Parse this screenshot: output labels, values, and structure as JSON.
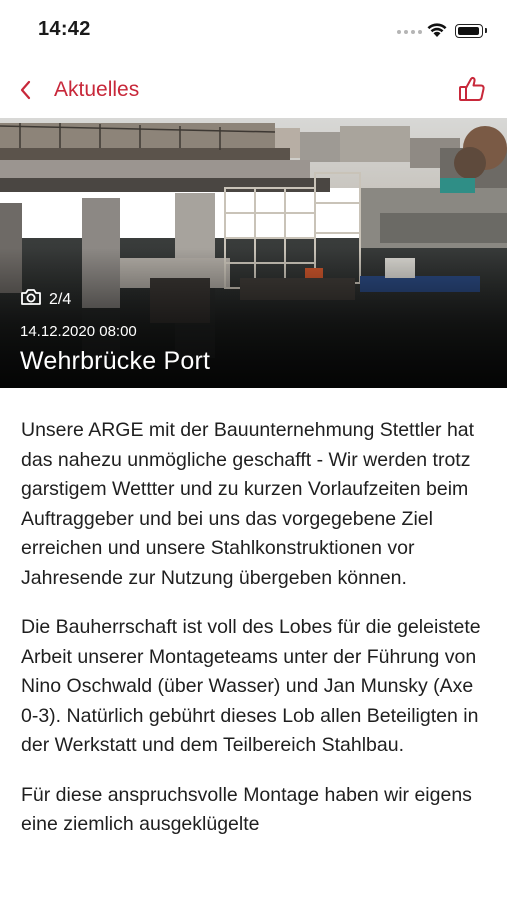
{
  "status_bar": {
    "time": "14:42"
  },
  "nav": {
    "back_label": "Aktuelles",
    "accent_color": "#c8283a"
  },
  "hero": {
    "photo_counter": "2/4",
    "date": "14.12.2020 08:00",
    "title": "Wehrbrücke Port"
  },
  "article": {
    "paragraphs": [
      "Unsere ARGE mit der Bauunternehmung Stettler hat das nahezu unmögliche geschafft - Wir werden trotz garstigem Wettter und zu kurzen Vorlaufzeiten beim Auftraggeber und bei uns das vorgegebene Ziel erreichen und unsere Stahlkonstruktionen vor Jahresende zur Nutzung übergeben können.",
      "Die Bauherrschaft ist voll des Lobes für die geleistete Arbeit unserer Montageteams unter der Führung von Nino Oschwald (über Wasser) und Jan Munsky (Axe 0-3). Natürlich gebührt dieses Lob allen Beteiligten in der Werkstatt und dem Teilbereich Stahlbau.",
      "Für diese anspruchsvolle Montage haben wir eigens eine ziemlich ausgeklügelte"
    ]
  }
}
